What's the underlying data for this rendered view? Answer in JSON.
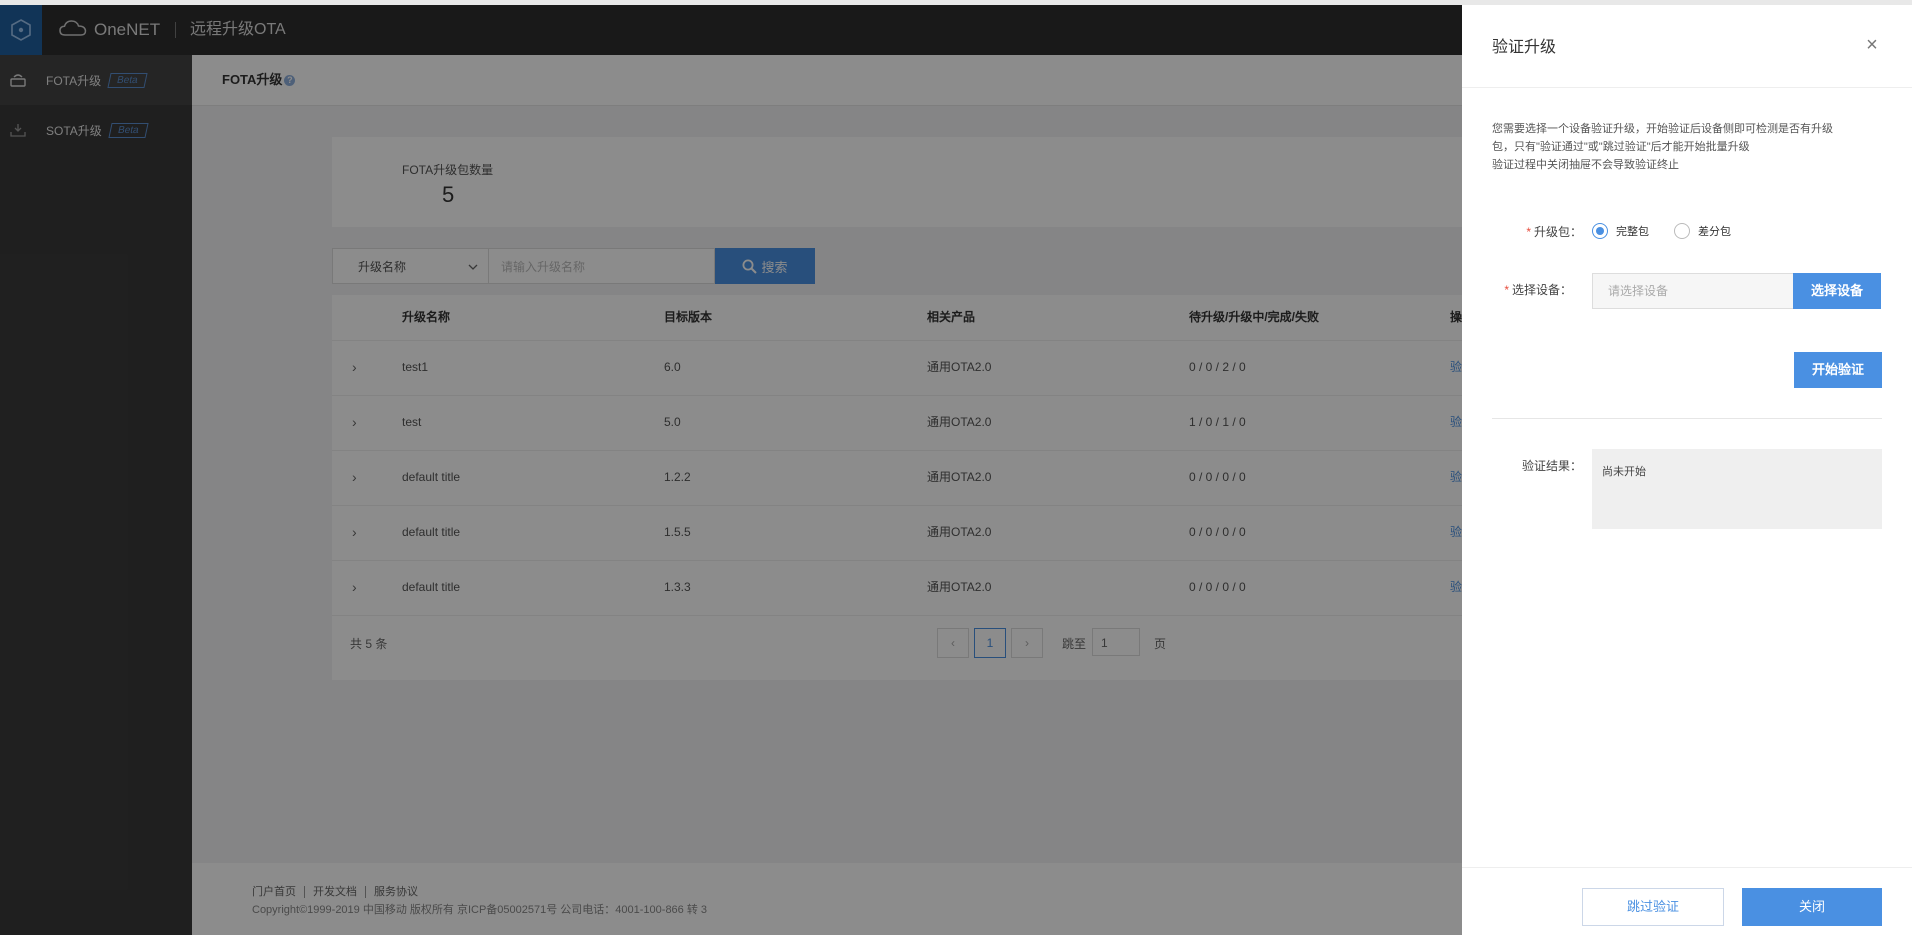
{
  "header": {
    "brand": "OneNET",
    "app_title": "远程升级OTA"
  },
  "sidebar": {
    "items": [
      {
        "label": "FOTA升级",
        "badge": "Beta"
      },
      {
        "label": "SOTA升级",
        "badge": "Beta"
      }
    ]
  },
  "breadcrumb": {
    "title": "FOTA升级",
    "help": "?"
  },
  "stats": {
    "label": "FOTA升级包数量",
    "value": "5"
  },
  "search": {
    "select_value": "升级名称",
    "placeholder": "请输入升级名称",
    "button_label": "搜索"
  },
  "table": {
    "columns": [
      "升级名称",
      "目标版本",
      "相关产品",
      "待升级/升级中/完成/失败",
      "操"
    ],
    "rows": [
      {
        "name": "test1",
        "version": "6.0",
        "product": "通用OTA2.0",
        "status": "0 / 0 / 2 / 0",
        "action": "验"
      },
      {
        "name": "test",
        "version": "5.0",
        "product": "通用OTA2.0",
        "status": "1 / 0 / 1 / 0",
        "action": "验"
      },
      {
        "name": "default title",
        "version": "1.2.2",
        "product": "通用OTA2.0",
        "status": "0 / 0 / 0 / 0",
        "action": "验"
      },
      {
        "name": "default title",
        "version": "1.5.5",
        "product": "通用OTA2.0",
        "status": "0 / 0 / 0 / 0",
        "action": "验"
      },
      {
        "name": "default title",
        "version": "1.3.3",
        "product": "通用OTA2.0",
        "status": "0 / 0 / 0 / 0",
        "action": "验"
      }
    ]
  },
  "pagination": {
    "total": "共 5 条",
    "prev": "‹",
    "current": "1",
    "next": "›",
    "jump_label": "跳至",
    "jump_value": "1",
    "page_suffix": "页"
  },
  "footer": {
    "links": [
      "门户首页",
      "开发文档",
      "服务协议"
    ],
    "copyright": "Copyright©1999-2019 中国移动 版权所有 京ICP备05002571号 公司电话：4001-100-866 转 3"
  },
  "drawer": {
    "title": "验证升级",
    "close": "×",
    "description": [
      "您需要选择一个设备验证升级，开始验证后设备侧即可检测是否有升级",
      "包，只有\"验证通过\"或\"跳过验证\"后才能开始批量升级",
      "验证过程中关闭抽屉不会导致验证终止"
    ],
    "package_label": "升级包：",
    "package_options": [
      "完整包",
      "差分包"
    ],
    "device_label": "选择设备：",
    "device_placeholder": "请选择设备",
    "select_device_button": "选择设备",
    "start_button": "开始验证",
    "result_label": "验证结果：",
    "result_value": "尚未开始",
    "skip_button": "跳过验证",
    "close_button": "关闭"
  },
  "colors": {
    "accent": "#4a90e2",
    "header_bg": "#2e2e2e",
    "sidebar_bg": "#3a3a3a",
    "required": "#e74c3c"
  }
}
